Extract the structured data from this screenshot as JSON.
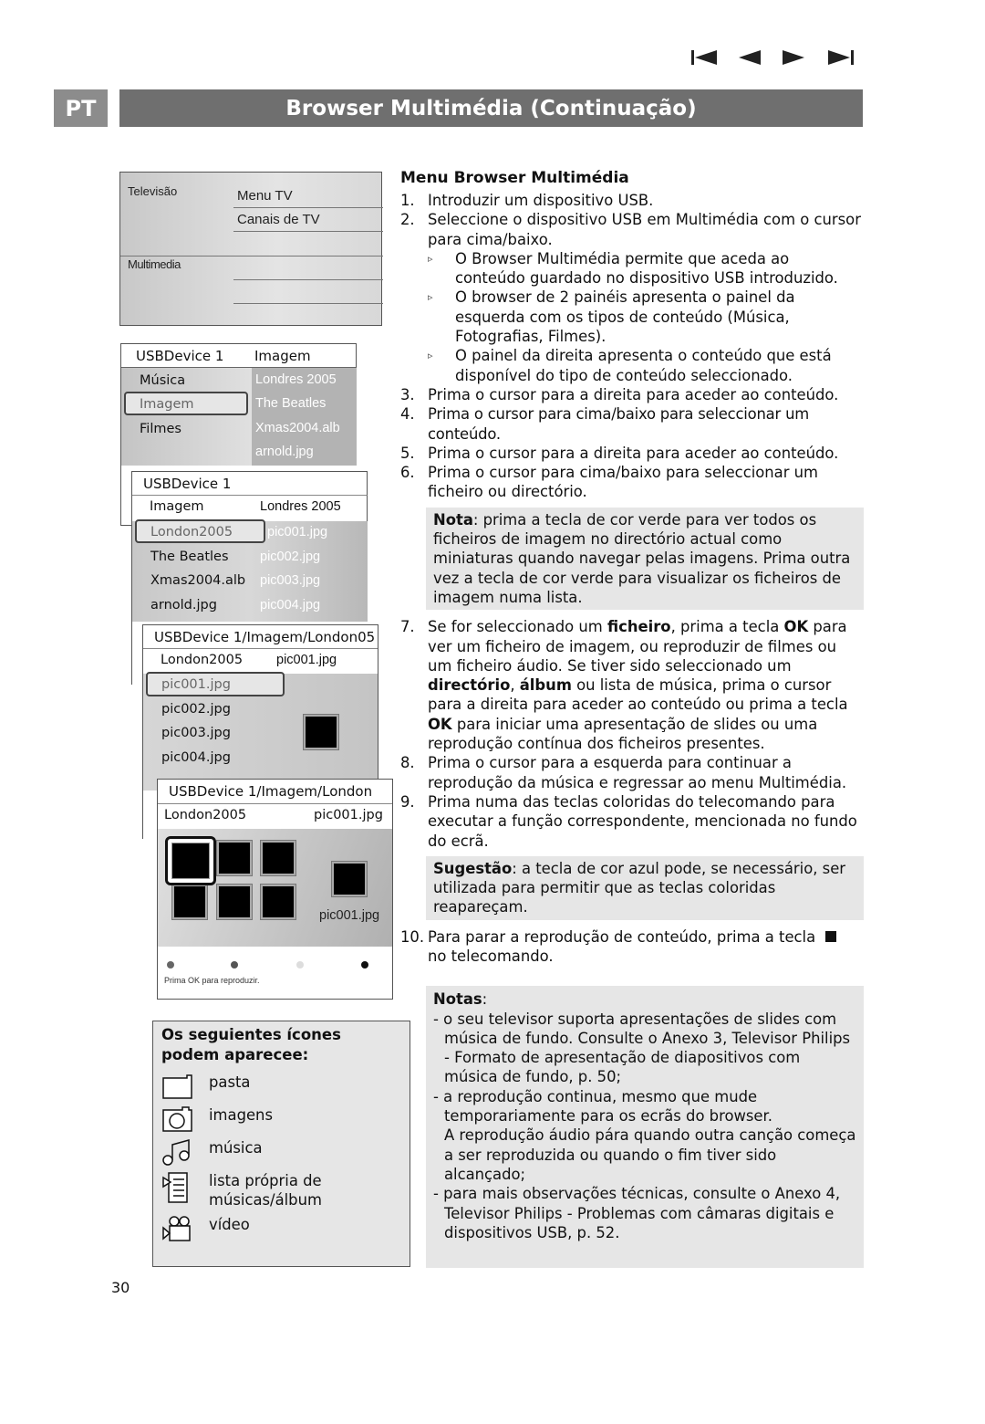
{
  "header": {
    "lang": "PT",
    "title": "Browser Multimédia (Continuação)",
    "nav_icons": [
      "skip-back-icon",
      "previous-icon",
      "next-icon",
      "skip-forward-icon"
    ]
  },
  "tv_menu": {
    "left": [
      "Televisão",
      "Multimedia"
    ],
    "right": [
      "Menu TV",
      "Canais de TV"
    ]
  },
  "panel1": {
    "header": [
      "USBDevice 1",
      "Imagem"
    ],
    "left": [
      "Música",
      "Imagem",
      "Filmes"
    ],
    "right": [
      "Londres 2005",
      "The Beatles",
      "Xmas2004.alb",
      "arnold.jpg"
    ]
  },
  "panel2": {
    "header": "USBDevice 1",
    "row": [
      "Imagem",
      "Londres 2005"
    ],
    "left": [
      "London2005",
      "The Beatles",
      "Xmas2004.alb",
      "arnold.jpg"
    ],
    "right": [
      "pic001.jpg",
      "pic002.jpg",
      "pic003.jpg",
      "pic004.jpg"
    ]
  },
  "panel3": {
    "header": "USBDevice 1/Imagem/London05",
    "row": [
      "London2005",
      "pic001.jpg"
    ],
    "left": [
      "pic001.jpg",
      "pic002.jpg",
      "pic003.jpg",
      "pic004.jpg"
    ]
  },
  "panel4": {
    "header": "USBDevice 1/Imagem/London",
    "row": [
      "London2005",
      "pic001.jpg"
    ],
    "preview_label": "pic001.jpg",
    "footer": "Prima OK para reproduzir.",
    "dot_colors": [
      "#666666",
      "#555555",
      "#dddddd",
      "#111111"
    ]
  },
  "icons_box": {
    "title": "Os seguientes ícones podem aparecee:",
    "items": [
      {
        "icon": "folder-icon",
        "label": "pasta"
      },
      {
        "icon": "camera-icon",
        "label": "imagens"
      },
      {
        "icon": "music-icon",
        "label": "música"
      },
      {
        "icon": "playlist-icon",
        "label": "lista própria de músicas/álbum"
      },
      {
        "icon": "video-camera-icon",
        "label": "vídeo"
      }
    ]
  },
  "page_number": "30",
  "main": {
    "heading": "Menu Browser Multimédia",
    "steps_a": [
      {
        "n": "1.",
        "text": "Introduzir um dispositivo USB."
      },
      {
        "n": "2.",
        "text": "Seleccione o dispositivo USB em Multimédia com o cursor para cima/baixo."
      }
    ],
    "bullets": [
      "O Browser Multimédia permite que aceda ao conteúdo guardado no dispositivo USB introduzido.",
      "O browser de 2 painéis apresenta o painel da esquerda com os tipos de conteúdo (Música, Fotografias, Filmes).",
      "O painel da direita apresenta o conteúdo que está disponível do tipo de conteúdo seleccionado."
    ],
    "steps_b": [
      {
        "n": "3.",
        "text": "Prima o cursor para a direita para aceder ao conteúdo."
      },
      {
        "n": "4.",
        "text": "Prima o cursor para cima/baixo para seleccionar um conteúdo."
      },
      {
        "n": "5.",
        "text": "Prima o cursor para a direita para aceder ao conteúdo."
      },
      {
        "n": "6.",
        "text": "Prima o cursor para cima/baixo para seleccionar um ficheiro ou directório."
      }
    ],
    "nota": {
      "label": "Nota",
      "text": ": prima a tecla de cor verde para ver todos os ficheiros de imagem no directório actual como miniaturas quando navegar pelas imagens. Prima outra vez a tecla de cor verde para visualizar os ficheiros de imagem numa lista."
    },
    "step7": {
      "n": "7.",
      "parts": [
        "Se for seleccionado um ",
        "ficheiro",
        ", prima a tecla ",
        "OK",
        " para ver um ficheiro de imagem, ou reproduzir de filmes ou um ficheiro áudio.  Se tiver sido seleccionado um ",
        "directório",
        ", ",
        "álbum",
        " ou lista de música, prima o cursor para a direita para aceder ao conteúdo ou prima a tecla ",
        "OK",
        " para iniciar uma apresentação de slides ou uma reprodução contínua dos ficheiros presentes."
      ]
    },
    "steps_c": [
      {
        "n": "8.",
        "text": "Prima o cursor para a esquerda para continuar a reprodução da música e regressar ao menu Multimédia."
      },
      {
        "n": "9.",
        "text": "Prima numa das teclas coloridas do telecomando para executar a função correspondente, mencionada no fundo do ecrã."
      }
    ],
    "sugestao": {
      "label": "Sugestão",
      "text": ": a tecla de cor azul pode, se necessário, ser utilizada para permitir que as teclas coloridas reapareçam."
    },
    "step10": {
      "n": "10.",
      "before": "Para parar a reprodução de conteúdo, prima a tecla",
      "after": "no telecomando."
    },
    "notas": {
      "label": "Notas",
      "items": [
        "- o seu televisor suporta apresentações de slides com música de fundo. Consulte o Anexo 3, Televisor Philips - Formato de apresentação de diapositivos com música de fundo, p. 50;",
        "- a reprodução continua, mesmo que mude temporariamente para os ecrãs do browser.",
        "A reprodução áudio pára quando outra canção começa a ser reproduzida ou quando o fim tiver sido alcançado;",
        "- para mais observações técnicas, consulte o Anexo 4, Televisor Philips - Problemas com câmaras digitais e dispositivos USB, p. 52."
      ]
    }
  }
}
